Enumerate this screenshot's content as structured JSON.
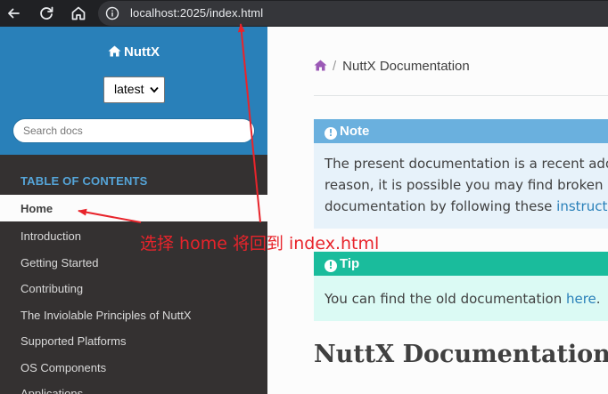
{
  "browser": {
    "url_host": "localhost:2025",
    "url_path": "/index.html"
  },
  "sidebar": {
    "brand": "NuttX",
    "version_selected": "latest",
    "search_placeholder": "Search docs",
    "toc_caption": "TABLE OF CONTENTS",
    "items": [
      {
        "label": "Home",
        "current": true
      },
      {
        "label": "Introduction"
      },
      {
        "label": "Getting Started"
      },
      {
        "label": "Contributing"
      },
      {
        "label": "The Inviolable Principles of NuttX"
      },
      {
        "label": "Supported Platforms"
      },
      {
        "label": "OS Components"
      },
      {
        "label": "Applications"
      }
    ]
  },
  "main": {
    "breadcrumb": "NuttX Documentation",
    "note": {
      "title": "Note",
      "line1": "The present documentation is a recent additi",
      "line2": "reason, it is possible you may find broken links",
      "line3_text": "documentation by following these ",
      "line3_link": "instructio"
    },
    "tip": {
      "title": "Tip",
      "text": "You can find the old documentation ",
      "link": "here",
      "tail": "."
    },
    "heading": "NuttX Documentation"
  },
  "annotation": {
    "text": "选择 home 将回到 index.html",
    "color": "#e8242b"
  },
  "colors": {
    "sidebar_top": "#2980b9",
    "sidebar_bg": "#343131",
    "note": "#6ab0de",
    "tip": "#1abc9c",
    "home_icon": "#9b59b6"
  }
}
